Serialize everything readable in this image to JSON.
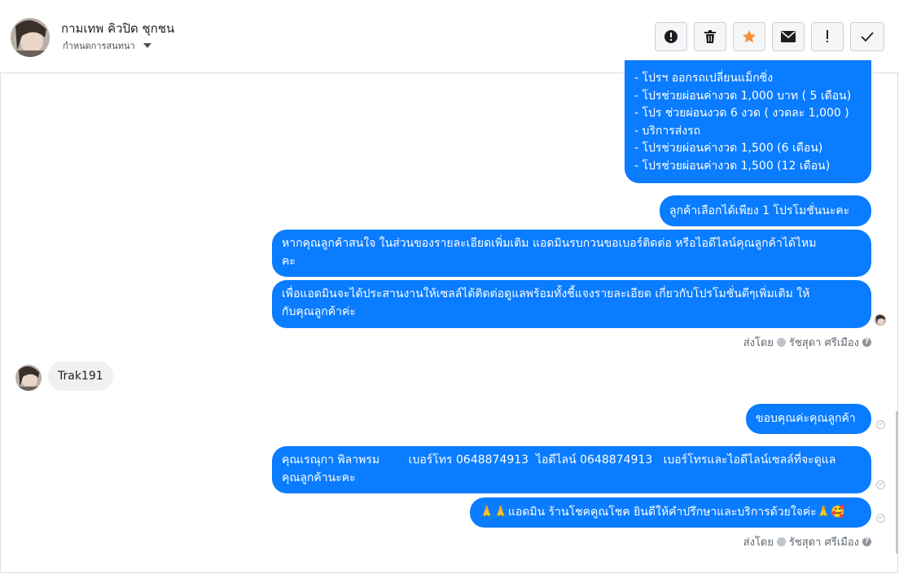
{
  "header": {
    "contact_name": "กามเทพ คิวปิด ชุกชน",
    "assign_label": "กำหนดการสนทนา"
  },
  "toolbar": {
    "buttons": [
      {
        "name": "spam",
        "icon": "alert-circle-icon",
        "color": "#1c1e21"
      },
      {
        "name": "delete",
        "icon": "trash-icon",
        "color": "#1c1e21"
      },
      {
        "name": "star",
        "icon": "star-icon",
        "color": "#f7923b"
      },
      {
        "name": "mark-unread",
        "icon": "envelope-icon",
        "color": "#1c1e21"
      },
      {
        "name": "follow-up",
        "icon": "exclamation-icon",
        "color": "#1c1e21"
      },
      {
        "name": "done",
        "icon": "check-icon",
        "color": "#1c1e21"
      }
    ]
  },
  "colors": {
    "accent": "#0a7cff",
    "incoming_bubble": "#f1f0f0"
  },
  "messages": {
    "promo_list": [
      "- โปรฯ ออกรถเปลี่ยนแม็กซิ่ง",
      "- โปรช่วยผ่อนค่างวด 1,000 บาท ( 5 เดือน)",
      "- โปร ช่วยผ่อนงวด 6 งวด ( งวดละ 1,000 )",
      "- บริการส่งรถ",
      "- โปรช่วยผ่อนค่างวด 1,500 (6 เดือน)",
      "- โปรช่วยผ่อนค่างวด 1,500 (12 เดือน)"
    ],
    "choose_one": "ลูกค้าเลือกได้เพียง 1 โปรโมชั่นนะคะ",
    "ask_contact": [
      "หากคุณลูกค้าสนใจ ในส่วนของรายละเอียดเพิ่มเติม แอดมินรบกวนขอเบอร์ติดต่อ หรือไอดีไลน์คุณลูกค้าได้ไหม",
      "คะ"
    ],
    "coordinate": [
      "เพื่อแอดมินจะได้ประสานงานให้เซลล์ได้ติดต่อดูแลพร้อมทั้งชี้แจงรายละเอียด เกี่ยวกับโปรโมชั่นดีๆเพิ่มเติม ให้",
      "กับคุณลูกค้าค่ะ"
    ],
    "sent_by_label": "ส่งโดย",
    "sent_by_name": "รัชสุดา ศรีเมือง",
    "incoming": "Trak191",
    "thanks": "ขอบคุณค่ะคุณลูกค้า",
    "sales_contact": [
      "คุณเรณุกา พิลาพรม        เบอร์โทร 0648874913  ไอดีไลน์ 0648874913   เบอร์โทรและไอดีไลน์เซลล์ที่จะดูแล",
      "คุณลูกค้านะคะ"
    ],
    "closing": "🙏🙏แอดมิน ร้านโชคคูณโชค ยินดีให้คำปรึกษาและบริการด้วยใจค่ะ🙏🥰",
    "sent_by_label_2": "ส่งโดย",
    "sent_by_name_2": "รัชสุดา ศรีเมือง"
  }
}
